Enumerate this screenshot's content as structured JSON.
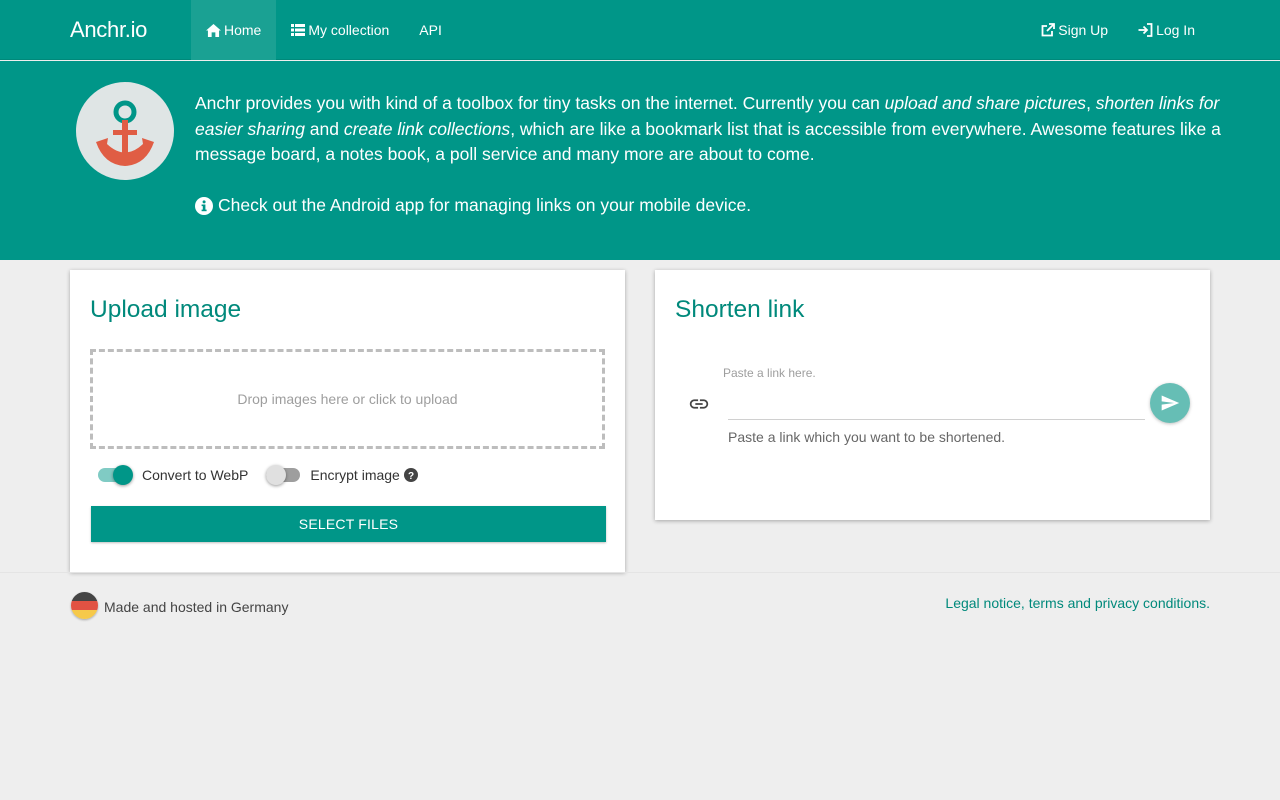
{
  "nav": {
    "brand": "Anchr.io",
    "home": "Home",
    "collection": "My collection",
    "api": "API",
    "signup": "Sign Up",
    "login": "Log In"
  },
  "hero": {
    "t1": "Anchr provides you with kind of a toolbox for tiny tasks on the internet. Currently you can ",
    "em1": "upload and share pictures",
    "t2": ", ",
    "em2": "shorten links for easier sharing",
    "t3": " and ",
    "em3": "create link collections",
    "t4": ", which are like a bookmark list that is accessible from everywhere. Awesome features like a message board, a notes book, a poll service and many more are about to come.",
    "android_note": "Check out the Android app for managing links on your mobile device."
  },
  "upload": {
    "title": "Upload image",
    "dropzone": "Drop images here or click to upload",
    "convert_label": "Convert to WebP",
    "convert_on": true,
    "encrypt_label": "Encrypt image",
    "encrypt_on": false,
    "select_button": "SELECT FILES"
  },
  "shorten": {
    "title": "Shorten link",
    "label": "Paste a link here.",
    "value": "",
    "helper": "Paste a link which you want to be shortened."
  },
  "footer": {
    "made": "Made and hosted in Germany",
    "legal": "Legal notice, terms and privacy conditions."
  },
  "colors": {
    "primary": "#009688",
    "primary_dark": "#00897b",
    "accent_light": "#80cbc4",
    "anchor": "#e05d44",
    "background": "#eeeeee"
  }
}
